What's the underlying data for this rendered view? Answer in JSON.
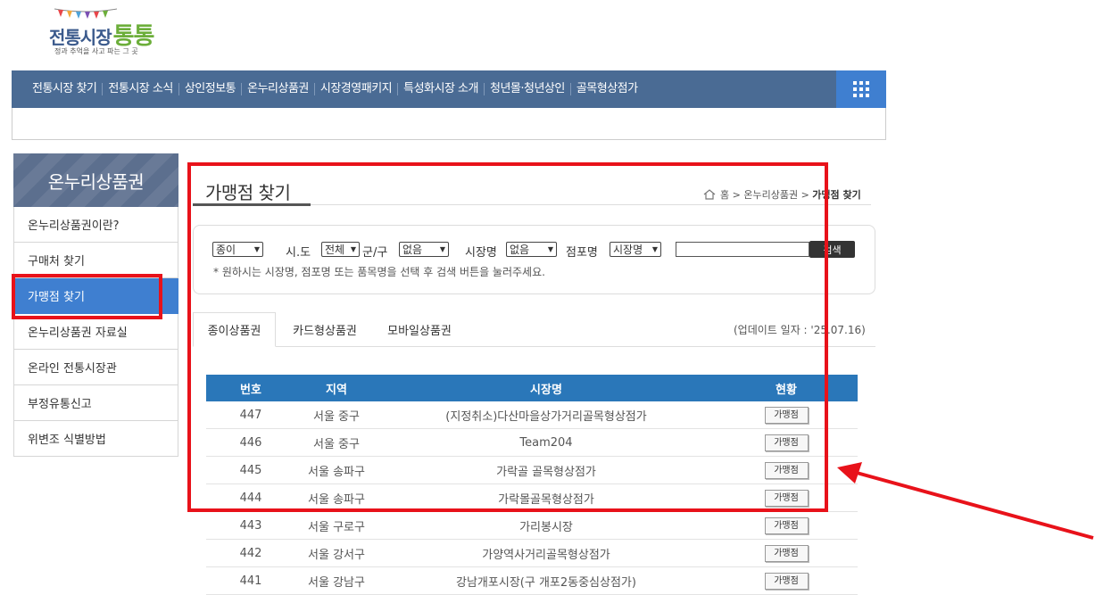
{
  "logo": {
    "title": "전통시장",
    "title_accent": "통통",
    "tagline": "정과 추억을 사고 파는 그 곳",
    "colors": {
      "title": "#3b5a8c",
      "accent": "#6cae3a"
    }
  },
  "gnb": {
    "items": [
      "전통시장 찾기",
      "전통시장 소식",
      "상인정보통",
      "온누리상품권",
      "시장경영패키지",
      "특성화시장 소개",
      "청년몰·청년상인",
      "골목형상점가"
    ],
    "menu_icon": "grid-menu-icon",
    "colors": {
      "bar": "#4a6b94",
      "menu_button": "#3f7fd0"
    }
  },
  "lnb": {
    "title": "온누리상품권",
    "items": [
      {
        "label": "온누리상품권이란?"
      },
      {
        "label": "구매처 찾기"
      },
      {
        "label": "가맹점 찾기",
        "active": true
      },
      {
        "label": "온누리상품권 자료실"
      },
      {
        "label": "온라인 전통시장관"
      },
      {
        "label": "부정유통신고"
      },
      {
        "label": "위변조 식별방법"
      }
    ],
    "colors": {
      "active": "#3f7fd0"
    }
  },
  "page": {
    "title": "가맹점 찾기",
    "breadcrumb": {
      "home": "홈",
      "section": "온누리상품권",
      "current": "가맹점 찾기"
    }
  },
  "search": {
    "type_select": "종이",
    "sido_label": "시.도",
    "sido_select": "전체",
    "gungu_label": "군/구",
    "gungu_select": "없음",
    "market_label": "시장명",
    "market_select": "없음",
    "store_label": "점포명",
    "store_select": "시장명",
    "keyword_value": "",
    "button_label": "검색",
    "hint": "* 원하시는 시장명, 점포명 또는 품목명을 선택 후 검색 버튼을 눌러주세요."
  },
  "tabs": {
    "items": [
      "종이상품권",
      "카드형상품권",
      "모바일상품권"
    ],
    "active": "종이상품권",
    "update_text": "(업데이트 일자 : '25.07.16)"
  },
  "table": {
    "headers": [
      "번호",
      "지역",
      "시장명",
      "현황"
    ],
    "rows": [
      {
        "no": "447",
        "region": "서울 중구",
        "market": "(지정취소)다산마을상가거리골목형상점가",
        "status": "가맹점"
      },
      {
        "no": "446",
        "region": "서울 중구",
        "market": "Team204",
        "status": "가맹점"
      },
      {
        "no": "445",
        "region": "서울 송파구",
        "market": "가락골 골목형상점가",
        "status": "가맹점"
      },
      {
        "no": "444",
        "region": "서울 송파구",
        "market": "가락몰골목형상점가",
        "status": "가맹점"
      },
      {
        "no": "443",
        "region": "서울 구로구",
        "market": "가리봉시장",
        "status": "가맹점"
      },
      {
        "no": "442",
        "region": "서울 강서구",
        "market": "가양역사거리골목형상점가",
        "status": "가맹점"
      },
      {
        "no": "441",
        "region": "서울 강남구",
        "market": "강남개포시장(구 개포2동중심상점가)",
        "status": "가맹점"
      }
    ],
    "colors": {
      "header": "#2a77b9"
    }
  },
  "annotations": {
    "highlight_color": "#e8121a"
  }
}
